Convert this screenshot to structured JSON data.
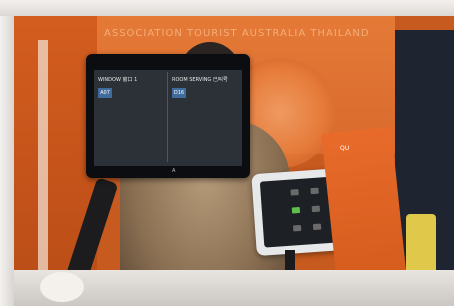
{
  "photo": {
    "wall_text": "ASSOCIATION TOURIST AUSTRALIA THAILAND",
    "monitor": {
      "left_title": "WINDOW 窗口 1",
      "right_title": "ROOM SERVING 已叫号",
      "left_button": "A07",
      "right_button": "D16",
      "brand": "A"
    },
    "sign_text": "QU",
    "accent_color": "#e87a35"
  }
}
